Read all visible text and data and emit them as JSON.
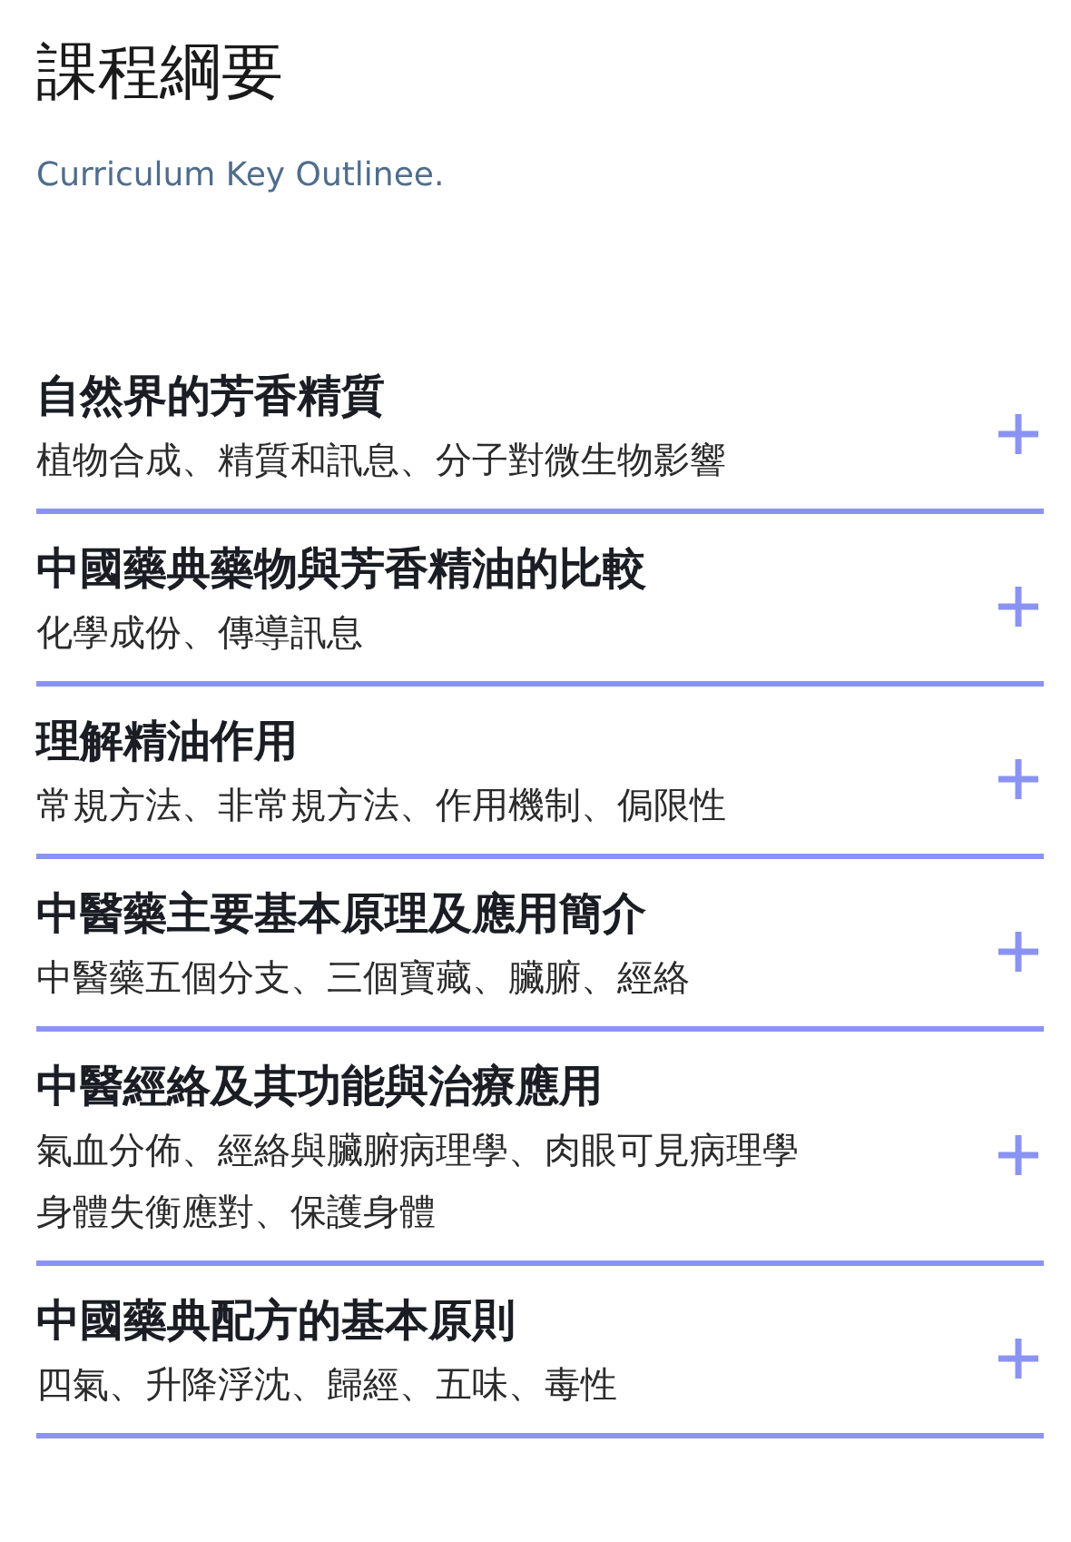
{
  "header": {
    "title": "課程綱要",
    "subtitle": "Curriculum Key Outlinee."
  },
  "sections": [
    {
      "title": "自然界的芳香精質",
      "summary_lines": [
        "植物合成、精質和訊息、分子對微生物影響"
      ],
      "expanded": false
    },
    {
      "title": "中國藥典藥物與芳香精油的比較",
      "summary_lines": [
        "化學成份、傳導訊息"
      ],
      "expanded": false
    },
    {
      "title": "理解精油作用",
      "summary_lines": [
        "常規方法、非常規方法、作用機制、侷限性"
      ],
      "expanded": false
    },
    {
      "title": "中醫藥主要基本原理及應用簡介",
      "summary_lines": [
        "中醫藥五個分支、三個寶藏、臟腑、經絡"
      ],
      "expanded": false
    },
    {
      "title": "中醫經絡及其功能與治療應用",
      "summary_lines": [
        "氣血分佈、經絡與臟腑病理學、肉眼可見病理學",
        "身體失衡應對、保護身體"
      ],
      "expanded": false
    },
    {
      "title": "中國藥典配方的基本原則",
      "summary_lines": [
        "四氣、升降浮沈、歸經、五味、毒性"
      ],
      "expanded": false
    }
  ]
}
